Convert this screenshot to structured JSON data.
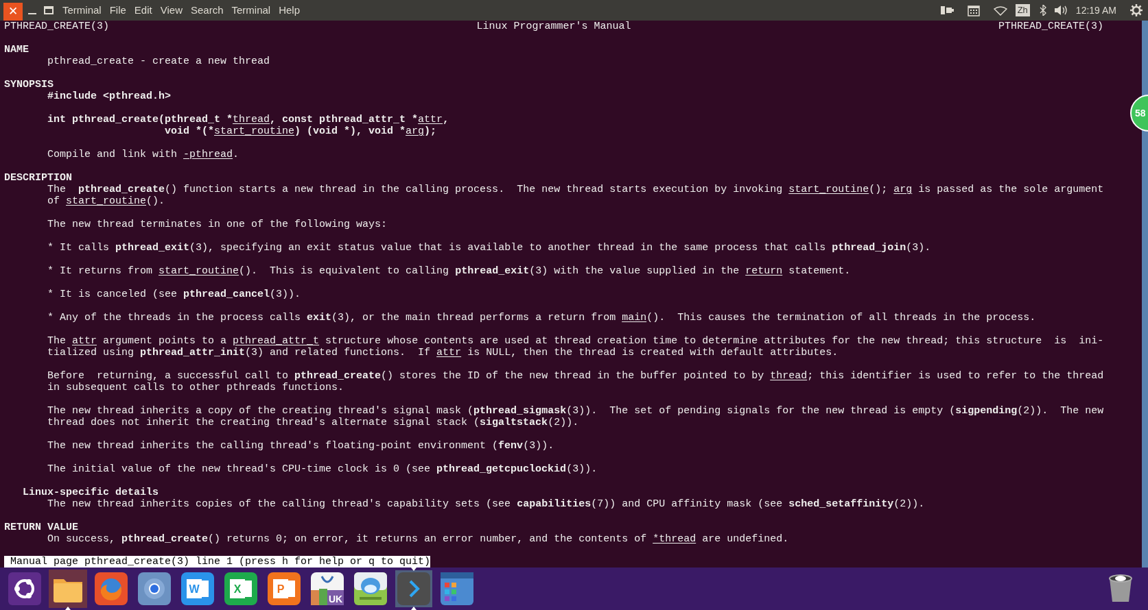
{
  "top_bar": {
    "close_button": "✕",
    "menu": [
      "Terminal",
      "File",
      "Edit",
      "View",
      "Search",
      "Terminal",
      "Help"
    ],
    "input_method": "Zh",
    "clock": "12:19 AM"
  },
  "man_page": {
    "header": {
      "left": "PTHREAD_CREATE(3)",
      "center": "Linux Programmer's Manual",
      "right": "PTHREAD_CREATE(3)"
    },
    "blocks": [
      [
        {
          "kind": "heading",
          "segments": [
            "NAME"
          ]
        },
        {
          "kind": "body",
          "segments": [
            "pthread_create - create a new thread"
          ]
        }
      ],
      [
        {
          "kind": "heading",
          "segments": [
            "SYNOPSIS"
          ]
        },
        {
          "kind": "body",
          "segments": [
            {
              "text": "#include <pthread.h>",
              "kind": "bold"
            }
          ]
        }
      ],
      [
        {
          "kind": "body",
          "segments": [
            {
              "text": "int pthread_create(pthread_t *",
              "kind": "bold"
            },
            {
              "text": "thread",
              "kind": "underline"
            },
            {
              "text": ", const pthread_attr_t *",
              "kind": "bold"
            },
            {
              "text": "attr",
              "kind": "underline"
            },
            {
              "text": ",",
              "kind": "bold"
            }
          ]
        },
        {
          "kind": "continuation",
          "segments": [
            {
              "text": "void *(*",
              "kind": "bold"
            },
            {
              "text": "start_routine",
              "kind": "underline"
            },
            {
              "text": ") (void *), void *",
              "kind": "bold"
            },
            {
              "text": "arg",
              "kind": "underline"
            },
            {
              "text": ");",
              "kind": "bold"
            }
          ]
        }
      ],
      [
        {
          "kind": "body",
          "segments": [
            "Compile and link with ",
            {
              "text": "-pthread",
              "kind": "underline"
            },
            "."
          ]
        }
      ],
      [
        {
          "kind": "heading",
          "segments": [
            "DESCRIPTION"
          ]
        },
        {
          "kind": "body",
          "segments": [
            "The  ",
            {
              "text": "pthread_create",
              "kind": "bold"
            },
            "() function starts a new thread in the calling process.  The new thread starts execution by invoking ",
            {
              "text": "start_routine",
              "kind": "underline"
            },
            "(); ",
            {
              "text": "arg",
              "kind": "underline"
            },
            " is passed as the sole argument"
          ]
        },
        {
          "kind": "body",
          "segments": [
            "of ",
            {
              "text": "start_routine",
              "kind": "underline"
            },
            "()."
          ]
        }
      ],
      [
        {
          "kind": "body",
          "segments": [
            "The new thread terminates in one of the following ways:"
          ]
        }
      ],
      [
        {
          "kind": "body",
          "segments": [
            "* It calls ",
            {
              "text": "pthread_exit",
              "kind": "bold"
            },
            "(3), specifying an exit status value that is available to another thread in the same process that calls ",
            {
              "text": "pthread_join",
              "kind": "bold"
            },
            "(3)."
          ]
        }
      ],
      [
        {
          "kind": "body",
          "segments": [
            "* It returns from ",
            {
              "text": "start_routine",
              "kind": "underline"
            },
            "().  This is equivalent to calling ",
            {
              "text": "pthread_exit",
              "kind": "bold"
            },
            "(3) with the value supplied in the ",
            {
              "text": "return",
              "kind": "underline"
            },
            " statement."
          ]
        }
      ],
      [
        {
          "kind": "body",
          "segments": [
            "* It is canceled (see ",
            {
              "text": "pthread_cancel",
              "kind": "bold"
            },
            "(3))."
          ]
        }
      ],
      [
        {
          "kind": "body",
          "segments": [
            "* Any of the threads in the process calls ",
            {
              "text": "exit",
              "kind": "bold"
            },
            "(3), or the main thread performs a return from ",
            {
              "text": "main",
              "kind": "underline"
            },
            "().  This causes the termination of all threads in the process."
          ]
        }
      ],
      [
        {
          "kind": "body",
          "segments": [
            "The ",
            {
              "text": "attr",
              "kind": "underline"
            },
            " argument points to a ",
            {
              "text": "pthread_attr_t",
              "kind": "underline"
            },
            " structure whose contents are used at thread creation time to determine attributes for the new thread; this structure  is  ini-"
          ]
        },
        {
          "kind": "body",
          "segments": [
            "tialized using ",
            {
              "text": "pthread_attr_init",
              "kind": "bold"
            },
            "(3) and related functions.  If ",
            {
              "text": "attr",
              "kind": "underline"
            },
            " is NULL, then the thread is created with default attributes."
          ]
        }
      ],
      [
        {
          "kind": "body",
          "segments": [
            "Before  returning, a successful call to ",
            {
              "text": "pthread_create",
              "kind": "bold"
            },
            "() stores the ID of the new thread in the buffer pointed to by ",
            {
              "text": "thread",
              "kind": "underline"
            },
            "; this identifier is used to refer to the thread"
          ]
        },
        {
          "kind": "body",
          "segments": [
            "in subsequent calls to other pthreads functions."
          ]
        }
      ],
      [
        {
          "kind": "body",
          "segments": [
            "The new thread inherits a copy of the creating thread's signal mask (",
            {
              "text": "pthread_sigmask",
              "kind": "bold"
            },
            "(3)).  The set of pending signals for the new thread is empty (",
            {
              "text": "sigpending",
              "kind": "bold"
            },
            "(2)).  The new"
          ]
        },
        {
          "kind": "body",
          "segments": [
            "thread does not inherit the creating thread's alternate signal stack (",
            {
              "text": "sigaltstack",
              "kind": "bold"
            },
            "(2))."
          ]
        }
      ],
      [
        {
          "kind": "body",
          "segments": [
            "The new thread inherits the calling thread's floating-point environment (",
            {
              "text": "fenv",
              "kind": "bold"
            },
            "(3))."
          ]
        }
      ],
      [
        {
          "kind": "body",
          "segments": [
            "The initial value of the new thread's CPU-time clock is 0 (see ",
            {
              "text": "pthread_getcpuclockid",
              "kind": "bold"
            },
            "(3))."
          ]
        }
      ],
      [
        {
          "kind": "subheading",
          "segments": [
            "Linux-specific details"
          ]
        },
        {
          "kind": "body",
          "segments": [
            "The new thread inherits copies of the calling thread's capability sets (see ",
            {
              "text": "capabilities",
              "kind": "bold"
            },
            "(7)) and CPU affinity mask (see ",
            {
              "text": "sched_setaffinity",
              "kind": "bold"
            },
            "(2))."
          ]
        }
      ],
      [
        {
          "kind": "heading",
          "segments": [
            "RETURN VALUE"
          ]
        },
        {
          "kind": "body",
          "segments": [
            "On success, ",
            {
              "text": "pthread_create",
              "kind": "bold"
            },
            "() returns 0; on error, it returns an error number, and the contents of ",
            {
              "text": "*thread",
              "kind": "underline"
            },
            " are undefined."
          ]
        }
      ]
    ],
    "status_line": "Manual page pthread_create(3) line 1 (press h for help or q to quit)"
  },
  "notification_badge": "58",
  "launcher": [
    {
      "kind": "ubuntu",
      "selected": false,
      "hovered": false,
      "running": false
    },
    {
      "kind": "folder",
      "selected": false,
      "hovered": true,
      "running": true
    },
    {
      "kind": "firefox",
      "selected": false,
      "hovered": false,
      "running": false
    },
    {
      "kind": "chromium",
      "selected": false,
      "hovered": false,
      "running": false
    },
    {
      "kind": "word",
      "label": "W",
      "selected": false,
      "hovered": false,
      "running": false
    },
    {
      "kind": "excel",
      "label": "X",
      "selected": false,
      "hovered": false,
      "running": false
    },
    {
      "kind": "powerpoint",
      "label": "P",
      "selected": false,
      "hovered": false,
      "running": false
    },
    {
      "kind": "software",
      "label": "UK",
      "selected": false,
      "hovered": false,
      "running": false
    },
    {
      "kind": "robot",
      "selected": false,
      "hovered": false,
      "running": false
    },
    {
      "kind": "terminal",
      "selected": true,
      "hovered": false,
      "running": true
    },
    {
      "kind": "workspaces",
      "selected": false,
      "hovered": false,
      "running": false
    }
  ]
}
